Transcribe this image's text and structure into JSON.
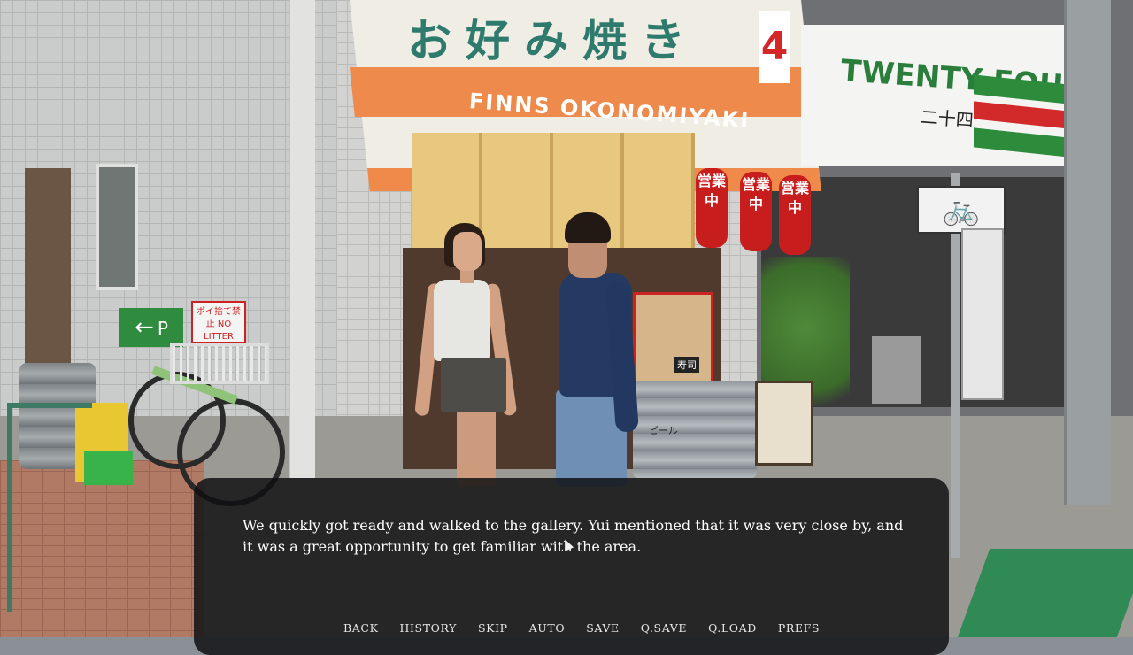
{
  "scene": {
    "awning_jp": "お好み焼き",
    "awning_en": "FINNS OKONOMIYAKI",
    "lantern_text": "営業中",
    "store_number": "4",
    "conv_store_name": "TWENTY FOUR",
    "conv_store_kanji": "二十四",
    "no_litter_sign": "ポイ捨て禁止 NO LITTER",
    "parking_sign": "P",
    "keg_label": "ビール",
    "sushi_label": "寿司"
  },
  "dialogue": {
    "text": "We quickly got ready and walked to the gallery. Yui mentioned that it was very close by, and\nit was a great opportunity to get familiar with the area."
  },
  "quick_menu": [
    {
      "label": "BACK"
    },
    {
      "label": "HISTORY"
    },
    {
      "label": "SKIP"
    },
    {
      "label": "AUTO"
    },
    {
      "label": "SAVE"
    },
    {
      "label": "Q.SAVE"
    },
    {
      "label": "Q.LOAD"
    },
    {
      "label": "PREFS"
    }
  ],
  "colors": {
    "dialog_bg": "#0f0f12",
    "text": "#ffffff",
    "awning_orange": "#ee8b4c",
    "awning_text": "#2e7b6e",
    "lantern_red": "#c81d1d"
  }
}
